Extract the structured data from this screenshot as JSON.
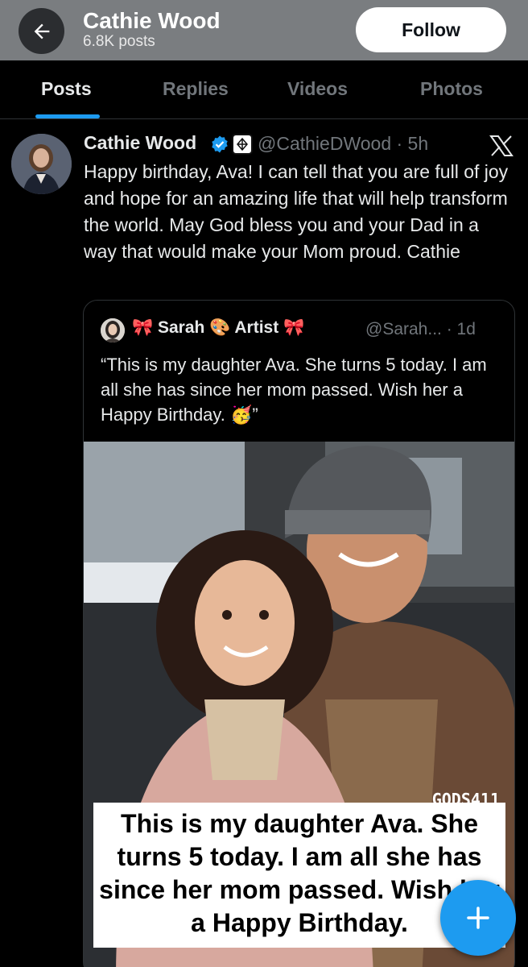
{
  "header": {
    "title": "Cathie Wood",
    "posts_count": "6.8K posts",
    "follow_label": "Follow"
  },
  "tabs": [
    {
      "label": "Posts",
      "active": true
    },
    {
      "label": "Replies",
      "active": false
    },
    {
      "label": "Videos",
      "active": false
    },
    {
      "label": "Photos",
      "active": false
    }
  ],
  "post": {
    "author_name": "Cathie Wood",
    "handle_time": "@CathieDWood · 5h",
    "text": "Happy birthday, Ava! I can tell that you are full of joy and hope for an amazing life that will help transform the world. May God bless you and your Dad in a way that would make your Mom proud. Cathie"
  },
  "quote": {
    "author_name": "🎀 Sarah 🎨 Artist 🎀",
    "handle_time": "@Sarah... · 1d",
    "text": "“This is my daughter Ava. She turns 5 today. I am all she has since her mom passed. Wish her a Happy Birthday. 🥳”",
    "image_watermark": "GODS411",
    "image_caption": "This is my daughter Ava. She turns 5 today. I am all she has since her mom passed. Wish her a Happy Birthday."
  },
  "colors": {
    "accent": "#1d9bf0",
    "header_bg": "#7a7d80",
    "background": "#000000"
  }
}
